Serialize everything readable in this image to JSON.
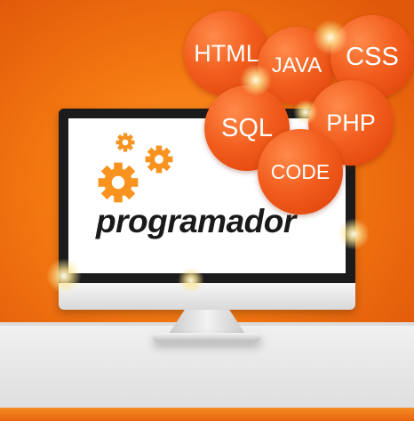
{
  "brand": {
    "text": "programador"
  },
  "bubbles": {
    "html": "HTML",
    "java": "JAVA",
    "css": "CSS",
    "sql": "SQL",
    "php": "PHP",
    "code": "CODE"
  },
  "colors": {
    "background": "#f57a12",
    "bubble": "#f25e1e",
    "gear": "#f7931e",
    "text": "#1a1a1a",
    "monitor_frame": "#1b1b1b",
    "floor": "#e8e8e8"
  },
  "icons": [
    "gear-icon",
    "monitor-icon"
  ]
}
